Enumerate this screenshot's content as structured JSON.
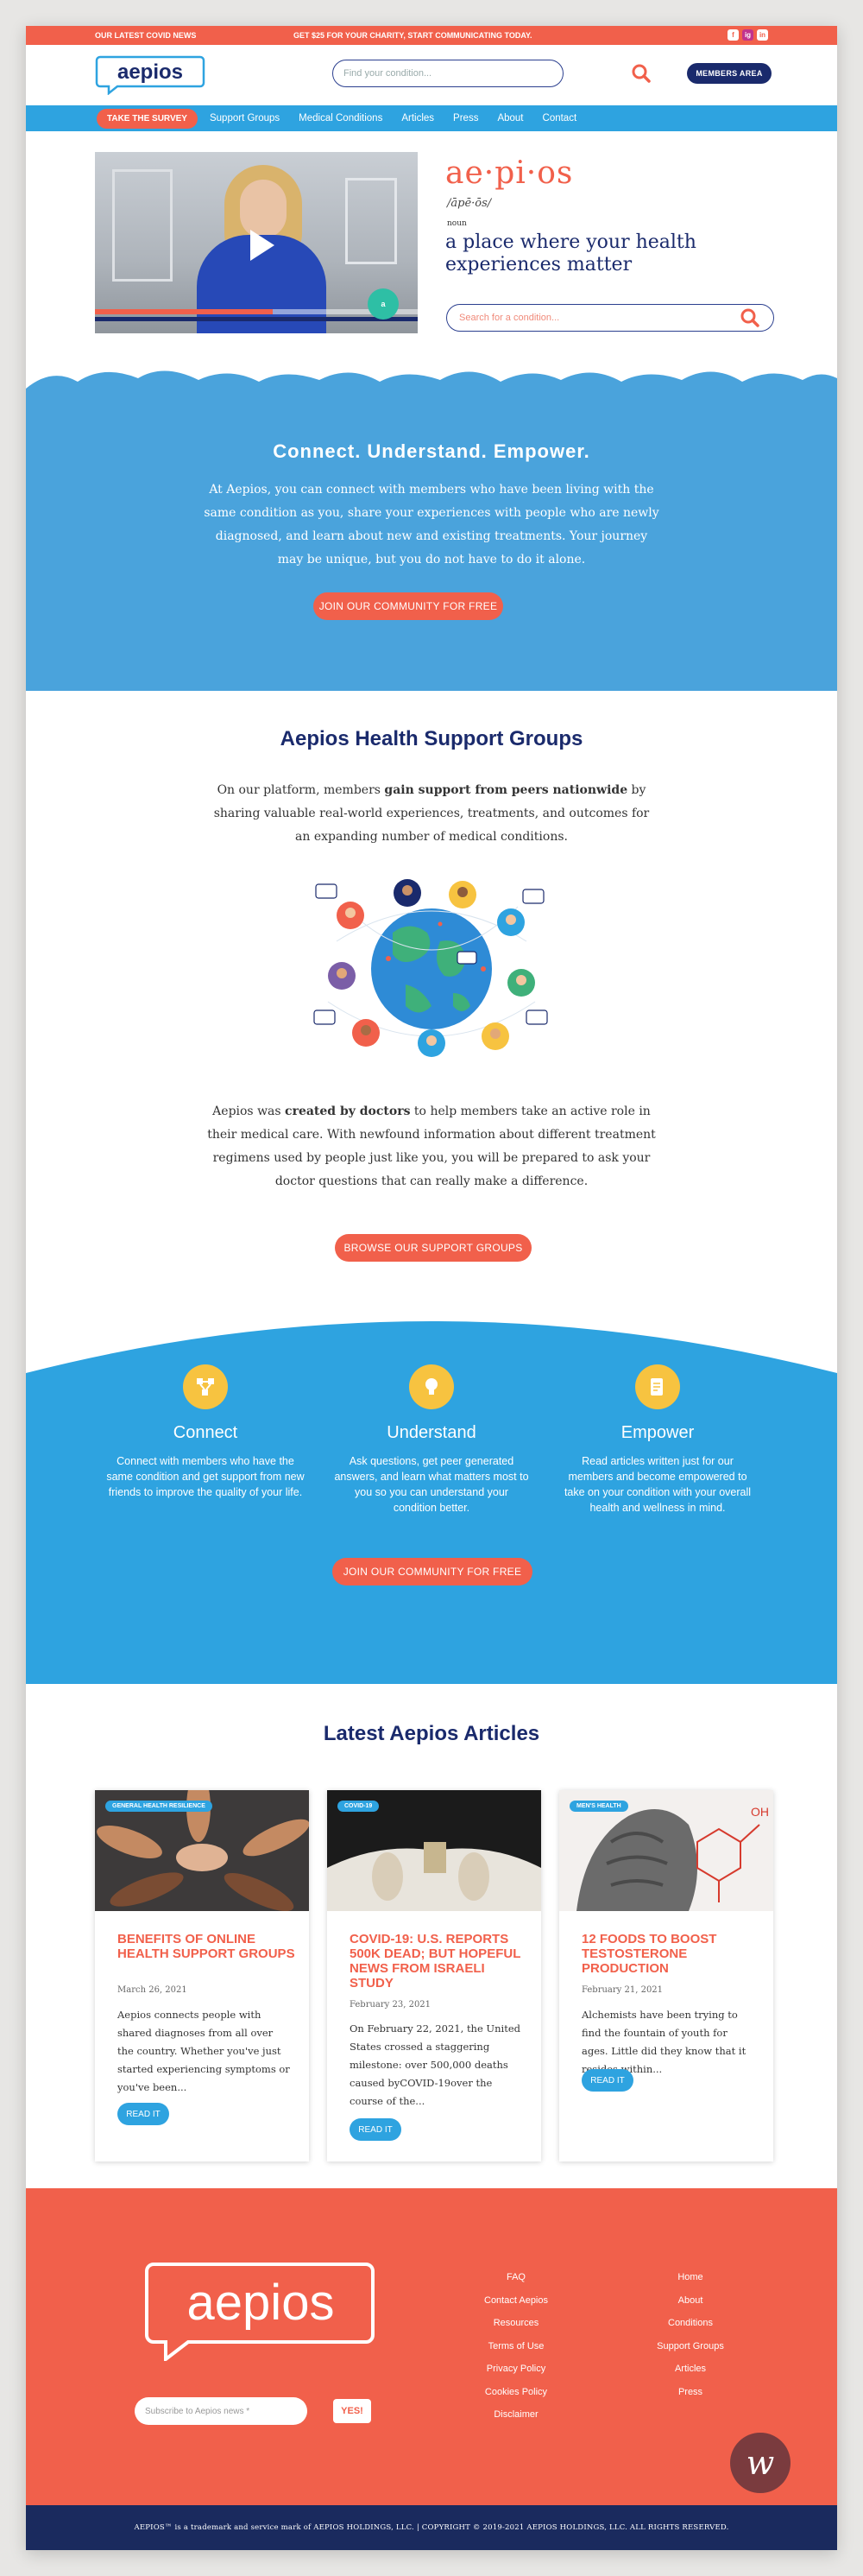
{
  "topbar": {
    "news": "OUR LATEST COVID NEWS",
    "promo": "GET $25 FOR YOUR CHARITY, START COMMUNICATING TODAY.",
    "socials": [
      "f",
      "ig",
      "in"
    ]
  },
  "header": {
    "logo_text": "aepios",
    "search_placeholder": "Find your condition...",
    "members_label": "MEMBERS AREA"
  },
  "nav": {
    "survey_label": "TAKE THE SURVEY",
    "links": [
      "Support Groups",
      "Medical Conditions",
      "Articles",
      "Press",
      "About",
      "Contact"
    ]
  },
  "hero": {
    "video_progress": 0.55,
    "badge_text": "a",
    "word": "ae·pi·os",
    "phonetic": "/āpē·ōs/",
    "part_of_speech": "noun",
    "definition": "a place where your health experiences matter",
    "search_placeholder": "Search for a condition..."
  },
  "connect": {
    "title": "Connect. Understand. Empower.",
    "body": "At Aepios, you can connect with members who have been living with the same condition as you, share your experiences with people who are newly diagnosed, and learn about new and existing treatments. Your journey may be unique, but you do not have to do it alone.",
    "cta": "JOIN OUR COMMUNITY FOR FREE"
  },
  "support_groups": {
    "title": "Aepios Health Support Groups",
    "p1_before": "On our platform, members ",
    "p1_bold": "gain support from peers nationwide",
    "p1_after": " by sharing valuable real-world experiences, treatments, and outcomes for an expanding number of medical conditions.",
    "p2_before": "Aepios was ",
    "p2_bold": "created by doctors",
    "p2_after": " to help members take an active role in their medical care. With newfound information about different treatment regimens used by people just like you, you will be prepared to ask your doctor questions that can really make a difference.",
    "cta": "BROWSE OUR SUPPORT GROUPS"
  },
  "features": {
    "items": [
      {
        "icon": "network-icon",
        "title": "Connect",
        "text": "Connect with members who have the same condition and get support from new friends to improve the quality of your life."
      },
      {
        "icon": "lightbulb-icon",
        "title": "Understand",
        "text": "Ask questions, get peer generated answers, and learn what matters most to you so you can understand your condition better."
      },
      {
        "icon": "document-icon",
        "title": "Empower",
        "text": "Read articles written just for our members and become empowered to take on your condition with your overall health and wellness in mind."
      }
    ],
    "cta": "JOIN OUR COMMUNITY FOR FREE"
  },
  "articles": {
    "title": "Latest Aepios Articles",
    "cards": [
      {
        "tag": "GENERAL HEALTH RESILIENCE",
        "title": "Benefits of Online Health Support Groups",
        "date": "March 26, 2021",
        "excerpt": "Aepios connects people with shared diagnoses from all over the country. Whether you've just started experiencing symptoms or you've been...",
        "read": "READ IT"
      },
      {
        "tag": "COVID-19",
        "title": "COVID-19: U.S. Reports 500K Dead; But Hopeful News from Israeli Study",
        "date": "February 23, 2021",
        "excerpt": "On February 22, 2021, the United States crossed a staggering milestone: over 500,000 deaths caused byCOVID-19over the course of the...",
        "read": "READ IT"
      },
      {
        "tag": "MEN'S HEALTH",
        "title": "12 Foods to Boost Testosterone Production",
        "date": "February 21, 2021",
        "excerpt": "Alchemists have been trying to find the fountain of youth for ages. Little did they know that it resides within...",
        "read": "READ IT"
      }
    ]
  },
  "footer": {
    "logo_text": "aepios",
    "subscribe_placeholder": "Subscribe to Aepios news *",
    "yes_label": "YES!",
    "col1": [
      "FAQ",
      "Contact Aepios",
      "Resources",
      "Terms of Use",
      "Privacy Policy",
      "Cookies Policy",
      "Disclaimer"
    ],
    "col2": [
      "Home",
      "About",
      "Conditions",
      "Support Groups",
      "Articles",
      "Press"
    ],
    "copyright": "AEPIOS™ is a trademark and service mark of AEPIOS HOLDINGS, LLC. | COPYRIGHT © 2019-2021 AEPIOS HOLDINGS, LLC. ALL RIGHTS RESERVED.",
    "chat_badge": "w"
  },
  "colors": {
    "coral": "#f1604b",
    "navy": "#1a2a6c",
    "sky": "#2ea3e0",
    "yellow": "#f7c340"
  }
}
